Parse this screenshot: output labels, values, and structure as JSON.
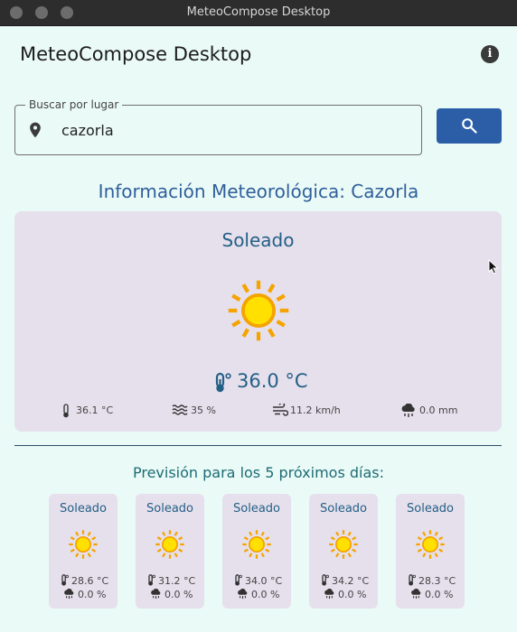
{
  "window": {
    "title": "MeteoCompose Desktop"
  },
  "app": {
    "title": "MeteoCompose Desktop",
    "info_icon": "info-icon"
  },
  "search": {
    "label": "Buscar por lugar",
    "value": "cazorla",
    "button_icon": "search-icon",
    "pin_icon": "location-pin-icon"
  },
  "weather": {
    "heading": "Información Meteorológica: Cazorla",
    "condition": "Soleado",
    "condition_icon": "sun-icon",
    "temperature": "36.0 °C",
    "metrics": {
      "feels_like": "36.1 °C",
      "humidity": "35 %",
      "wind": "11.2 km/h",
      "precipitation": "0.0 mm"
    }
  },
  "forecast": {
    "title": "Previsión para los 5 próximos días:",
    "days": [
      {
        "condition": "Soleado",
        "temp": "28.6 °C",
        "precip": "0.0 %"
      },
      {
        "condition": "Soleado",
        "temp": "31.2 °C",
        "precip": "0.0 %"
      },
      {
        "condition": "Soleado",
        "temp": "34.0 °C",
        "precip": "0.0 %"
      },
      {
        "condition": "Soleado",
        "temp": "34.2 °C",
        "precip": "0.0 %"
      },
      {
        "condition": "Soleado",
        "temp": "28.3 °C",
        "precip": "0.0 %"
      }
    ]
  },
  "colors": {
    "accent": "#2c5ea8",
    "card": "#e6e0ec",
    "background": "#eafaf7",
    "sun": "#ffd60a",
    "sun_ray": "#f5a300"
  }
}
